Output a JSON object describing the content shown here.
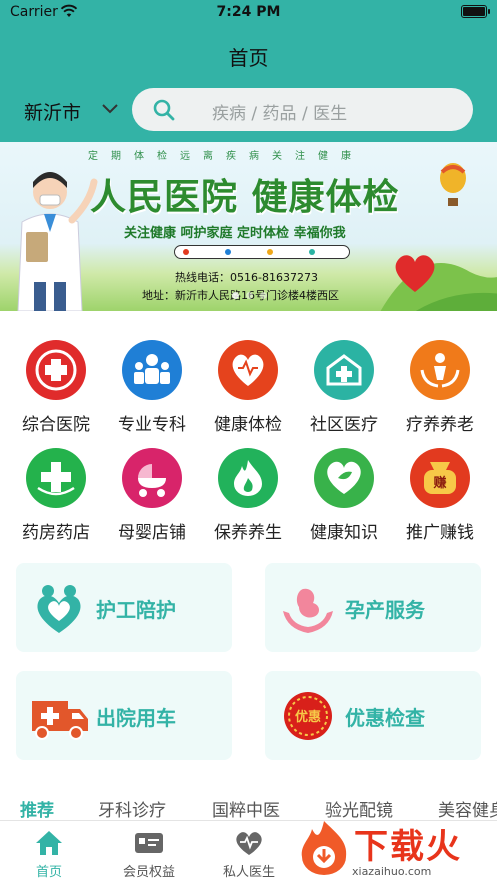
{
  "status_bar": {
    "carrier": "Carrier",
    "time": "7:24 PM"
  },
  "header": {
    "title": "首页",
    "city": "新沂市",
    "search_placeholder": "疾病 / 药品 / 医生"
  },
  "banner": {
    "tagline": "定期体检远离疾病关注健康",
    "headline": "人民医院 健康体检",
    "subline": "关注健康 呵护家庭 定时体检 幸福你我",
    "hotline": "热线电话：0516-81637273",
    "address": "地址：新沂市人民路16号门诊楼4楼西区"
  },
  "categories": [
    {
      "label": "综合医院",
      "icon": "hospital-cross-icon",
      "color": "#e02b2b"
    },
    {
      "label": "专业专科",
      "icon": "specialists-icon",
      "color": "#1f7fd6"
    },
    {
      "label": "健康体检",
      "icon": "heart-check-icon",
      "color": "#e5431d"
    },
    {
      "label": "社区医疗",
      "icon": "community-clinic-icon",
      "color": "#2bb3a3"
    },
    {
      "label": "疗养养老",
      "icon": "elder-care-icon",
      "color": "#f07a1a"
    },
    {
      "label": "药房药店",
      "icon": "pharmacy-cross-icon",
      "color": "#24b24c"
    },
    {
      "label": "母婴店铺",
      "icon": "baby-stroller-icon",
      "color": "#d8246a"
    },
    {
      "label": "保养养生",
      "icon": "flame-icon",
      "color": "#22b25b"
    },
    {
      "label": "健康知识",
      "icon": "leaf-heart-icon",
      "color": "#38b24a"
    },
    {
      "label": "推广赚钱",
      "icon": "money-bag-icon",
      "color": "#e23a1f"
    }
  ],
  "services": [
    {
      "label": "护工陪护",
      "icon": "caregiver-hearts-icon"
    },
    {
      "label": "孕产服务",
      "icon": "maternity-hands-icon"
    },
    {
      "label": "出院用车",
      "icon": "ambulance-icon"
    },
    {
      "label": "优惠检查",
      "icon": "discount-seal-icon"
    }
  ],
  "tabs": [
    {
      "label": "推荐",
      "active": true
    },
    {
      "label": "牙科诊疗",
      "active": false
    },
    {
      "label": "国粹中医",
      "active": false
    },
    {
      "label": "验光配镜",
      "active": false
    },
    {
      "label": "美容健身",
      "active": false
    }
  ],
  "bottom_nav": [
    {
      "label": "首页",
      "icon": "home-icon",
      "active": true
    },
    {
      "label": "会员权益",
      "icon": "member-card-icon",
      "active": false
    },
    {
      "label": "私人医生",
      "icon": "heartbeat-icon",
      "active": false
    }
  ],
  "watermark": {
    "text": "下载火",
    "url": "xiazaihuo.com"
  },
  "colors": {
    "primary": "#33b3a6",
    "card_bg": "#eefaf9"
  }
}
